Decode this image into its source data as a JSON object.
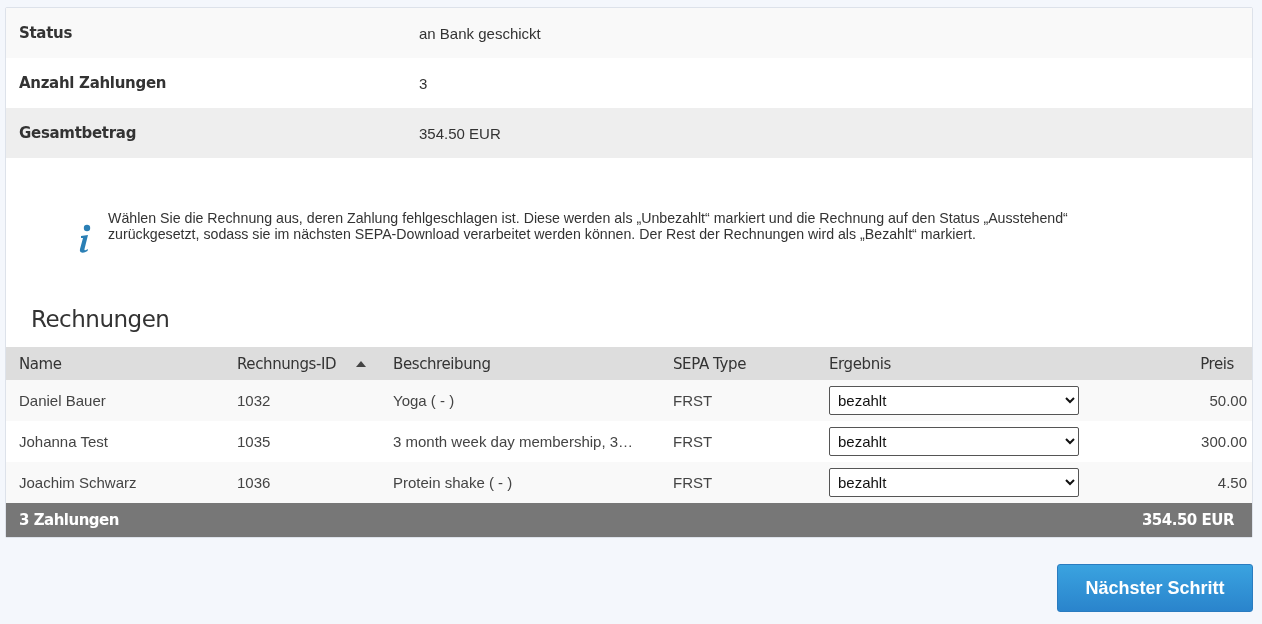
{
  "summary": [
    {
      "label": "Status",
      "value": "an Bank geschickt"
    },
    {
      "label": "Anzahl Zahlungen",
      "value": "3"
    },
    {
      "label": "Gesamtbetrag",
      "value": "354.50 EUR"
    }
  ],
  "info": "Wählen Sie die Rechnung aus, deren Zahlung fehlgeschlagen ist. Diese werden als „Unbezahlt“ markiert und die Rechnung auf den Status „Ausstehend“ zurückgesetzt, sodass sie im nächsten SEPA-Download verarbeitet werden können. Der Rest der Rechnungen wird als „Bezahlt“ markiert.",
  "table": {
    "title": "Rechnungen",
    "columns": [
      {
        "label": "Name",
        "sorted": false
      },
      {
        "label": "Rechnungs-ID",
        "sorted": true
      },
      {
        "label": "Beschreibung",
        "sorted": false
      },
      {
        "label": "SEPA Type",
        "sorted": false
      },
      {
        "label": "Ergebnis",
        "sorted": false
      },
      {
        "label": "Preis",
        "sorted": false
      }
    ],
    "rows": [
      {
        "name": "Daniel Bauer",
        "id": "1032",
        "description": "Yoga ( - )",
        "sepa_type": "FRST",
        "result": "bezahlt",
        "price": "50.00"
      },
      {
        "name": "Johanna Test",
        "id": "1035",
        "description": "3 month week day membership, 3…",
        "sepa_type": "FRST",
        "result": "bezahlt",
        "price": "300.00"
      },
      {
        "name": "Joachim Schwarz",
        "id": "1036",
        "description": "Protein shake ( - )",
        "sepa_type": "FRST",
        "result": "bezahlt",
        "price": "4.50"
      }
    ],
    "footer": {
      "count": "3 Zahlungen",
      "total": "354.50 EUR"
    }
  },
  "next_button": "Nächster Schritt"
}
